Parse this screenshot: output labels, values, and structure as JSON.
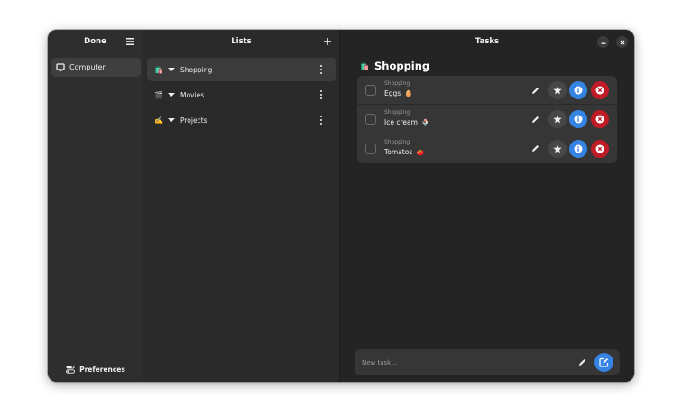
{
  "sidebar": {
    "title": "Done",
    "items": [
      {
        "label": "Computer",
        "icon": "computer-icon"
      }
    ],
    "footer": {
      "label": "Preferences",
      "icon": "preferences-icon"
    }
  },
  "lists_panel": {
    "title": "Lists",
    "lists": [
      {
        "emoji": "🛍️",
        "name": "Shopping",
        "active": true
      },
      {
        "emoji": "🎬",
        "name": "Movies",
        "active": false
      },
      {
        "emoji": "✍️",
        "name": "Projects",
        "active": false
      }
    ]
  },
  "tasks_panel": {
    "window_title": "Tasks",
    "heading": {
      "emoji": "🛍️",
      "text": "Shopping"
    },
    "tasks": [
      {
        "list": "Shopping",
        "title": "Eggs",
        "emoji": "🥚"
      },
      {
        "list": "Shopping",
        "title": "Ice cream",
        "emoji": "🍨"
      },
      {
        "list": "Shopping",
        "title": "Tomatos",
        "emoji": "🍅"
      }
    ],
    "new_task": {
      "placeholder": "New task...",
      "value": ""
    }
  },
  "colors": {
    "accent": "#3584e4",
    "destructive": "#c01c28",
    "window_bg": "#242424",
    "sidebar_bg": "#2e2e2e"
  }
}
